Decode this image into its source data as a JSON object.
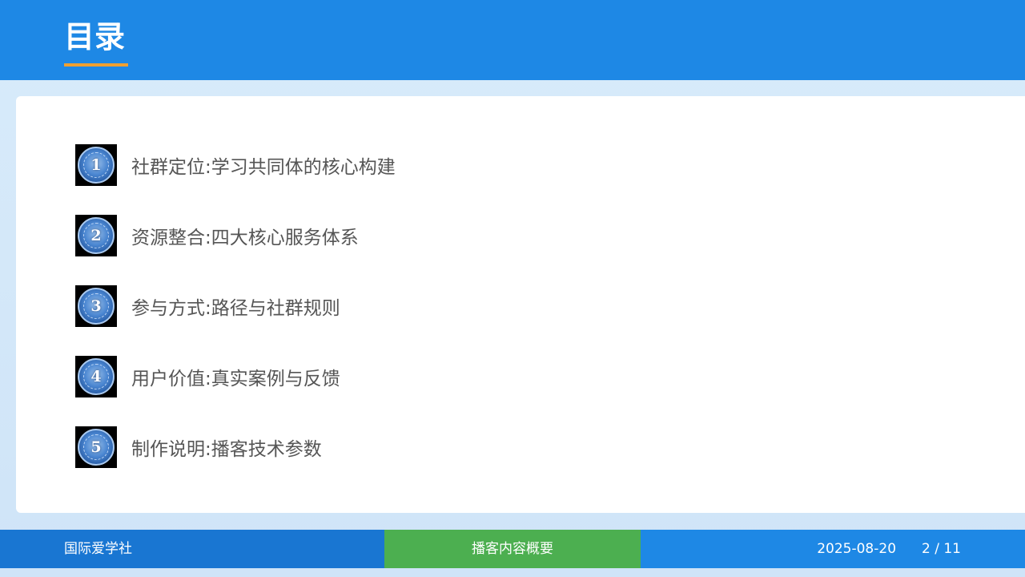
{
  "header": {
    "title": "目录",
    "accent_color": "#1e88e5",
    "underline_color": "#f0a030"
  },
  "toc": {
    "items": [
      {
        "number": "1",
        "label": "社群定位:学习共同体的核心构建"
      },
      {
        "number": "2",
        "label": "资源整合:四大核心服务体系"
      },
      {
        "number": "3",
        "label": "参与方式:路径与社群规则"
      },
      {
        "number": "4",
        "label": "用户价值:真实案例与反馈"
      },
      {
        "number": "5",
        "label": "制作说明:播客技术参数"
      }
    ]
  },
  "footer": {
    "organization": "国际爱学社",
    "section": "播客内容概要",
    "date": "2025-08-20",
    "page": "2 / 11",
    "section_color": "#4caf50"
  }
}
